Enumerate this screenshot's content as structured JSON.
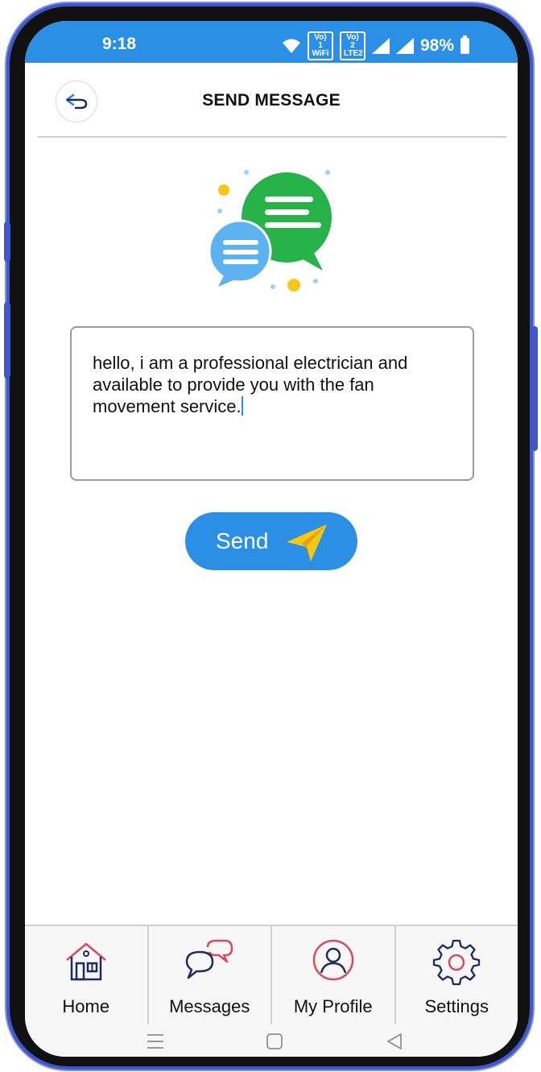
{
  "status_bar": {
    "time": "9:18",
    "sim1": "Vo) 1\nWiFi",
    "sim2": "Vo) 2\nLTE2",
    "battery": "98%"
  },
  "header": {
    "title": "SEND MESSAGE",
    "back_icon": "back-arrow-icon"
  },
  "illustration": {
    "icon": "chat-bubbles-illustration",
    "colors": {
      "green": "#27b24a",
      "blue": "#5db2f0",
      "yellow": "#f6c816"
    }
  },
  "message": {
    "text": "hello, i am a professional electrician and available to provide you with the fan movement service."
  },
  "send_button": {
    "label": "Send",
    "icon": "paper-plane-icon",
    "color": "#2c8fe6"
  },
  "bottom_nav": {
    "items": [
      {
        "label": "Home",
        "icon": "home-icon"
      },
      {
        "label": "Messages",
        "icon": "messages-icon"
      },
      {
        "label": "My Profile",
        "icon": "profile-icon"
      },
      {
        "label": "Settings",
        "icon": "settings-icon"
      }
    ]
  },
  "system_nav": {
    "recents": "recents-icon",
    "home": "home-square-icon",
    "back": "back-triangle-icon"
  },
  "theme": {
    "accent": "#2c8fe6",
    "frame": "#3f57c9"
  }
}
